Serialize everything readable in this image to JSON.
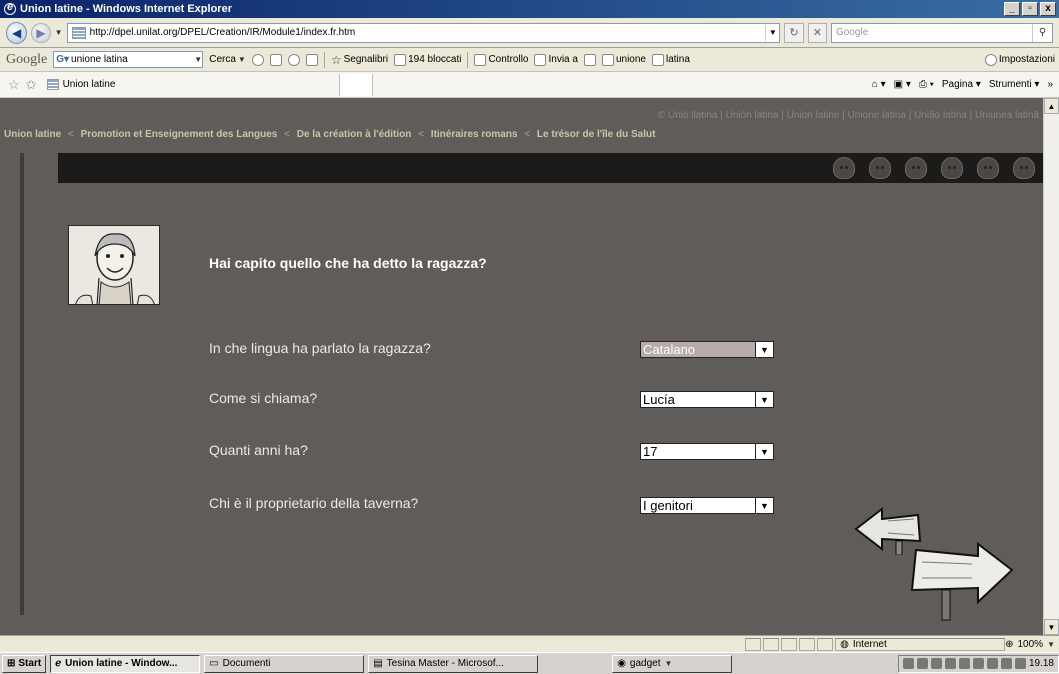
{
  "window": {
    "title": "Union latine - Windows Internet Explorer",
    "min": "_",
    "max": "▫",
    "close": "x"
  },
  "address": {
    "url": "http://dpel.unilat.org/DPEL/Creation/IR/Module1/index.fr.htm",
    "search_placeholder": "Google"
  },
  "google_toolbar": {
    "logo": "Google",
    "query": "unione latina",
    "cerca": "Cerca",
    "segnalibri": "Segnalibri",
    "bloccati": "194 bloccati",
    "controllo": "Controllo",
    "invia": "Invia a",
    "term1": "unione",
    "term2": "latina",
    "impostazioni": "Impostazioni"
  },
  "tabbar": {
    "tab_title": "Union latine",
    "pagina": "Pagina",
    "strumenti": "Strumenti"
  },
  "page": {
    "credits": "© Unió llatina | Unión latina | Union latine | Unione latina | União latina | Uniunea latină",
    "breadcrumbs": [
      "Union latine",
      "Promotion et Enseignement des Langues",
      "De la création à l'édition",
      "Itinéraires romans",
      "Le trésor de l'île du Salut"
    ],
    "question": "Hai capito quello che ha detto la ragazza?",
    "items": [
      {
        "label": "In che lingua ha parlato la ragazza?",
        "value": "Catalano"
      },
      {
        "label": "Come si chiama?",
        "value": "Lucía"
      },
      {
        "label": "Quanti anni ha?",
        "value": "17"
      },
      {
        "label": "Chi è il proprietario della taverna?",
        "value": "I genitori"
      }
    ]
  },
  "status": {
    "zone": "Internet",
    "zoom": "100%"
  },
  "taskbar": {
    "start": "Start",
    "task1": "Union latine - Window...",
    "task2": "Documenti",
    "task3": "Tesina Master - Microsof...",
    "gadget": "gadget",
    "clock": "19.18"
  }
}
